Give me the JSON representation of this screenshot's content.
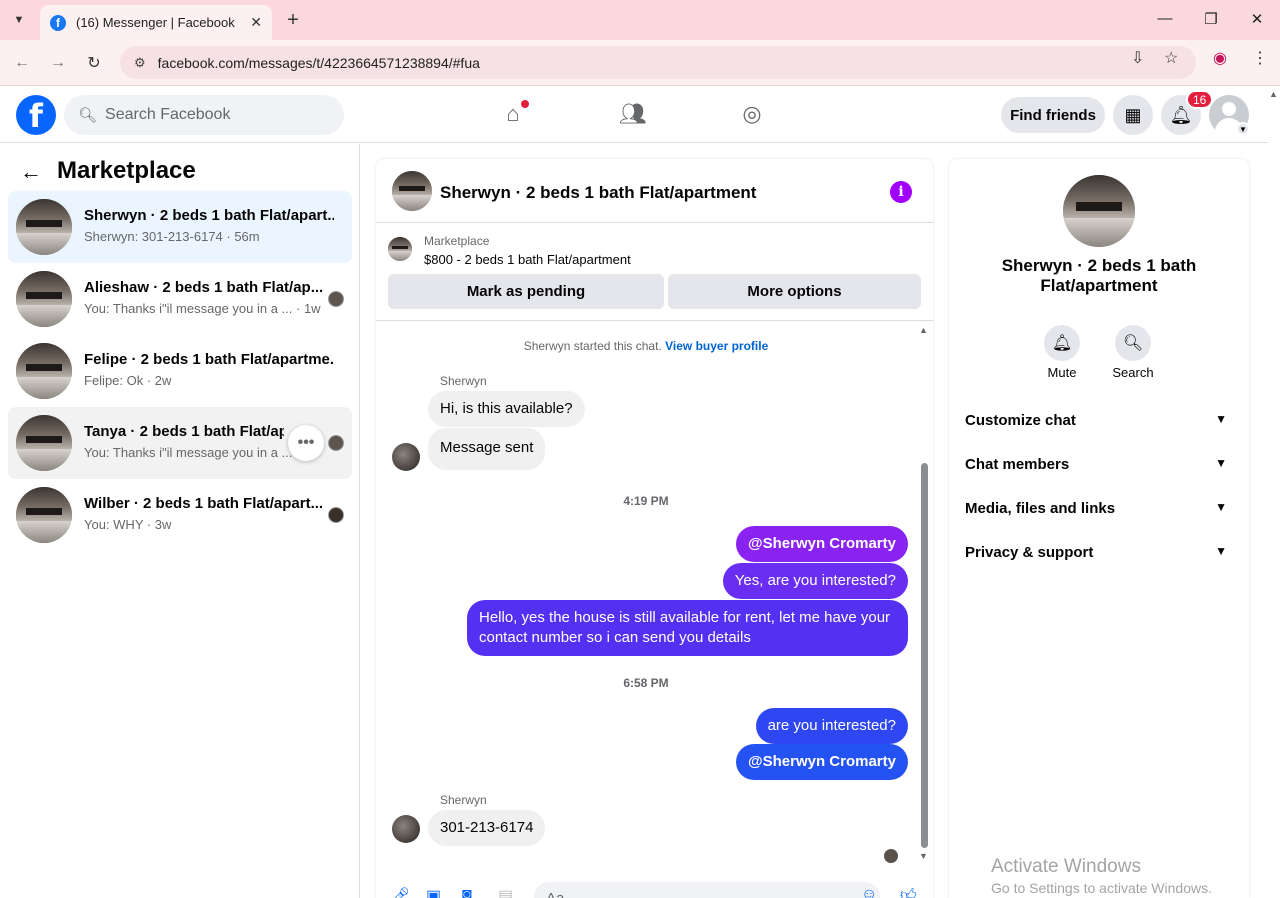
{
  "browser": {
    "tab_title": "(16) Messenger | Facebook",
    "tab_close": "✕",
    "new_tab": "+",
    "url": "facebook.com/messages/t/4223664571238894/#fua",
    "minimize": "—",
    "restore": "❐",
    "close": "✕"
  },
  "header": {
    "search_placeholder": "Search Facebook",
    "find_friends": "Find friends",
    "notifications_count": "16",
    "brand_color": "#0866ff"
  },
  "sidebar": {
    "title": "Marketplace",
    "conversations": [
      {
        "name": "Sherwyn · 2 beds 1 bath Flat/apart...",
        "snippet": "Sherwyn: 301-213-6174 · 56m"
      },
      {
        "name": "Alieshaw · 2 beds 1 bath Flat/ap...",
        "snippet": "You: Thanks i\"il message you in a ... · 1w"
      },
      {
        "name": "Felipe · 2 beds 1 bath Flat/apartme...",
        "snippet": "Felipe: Ok · 2w"
      },
      {
        "name": "Tanya · 2 beds 1 bath Flat/apart...",
        "snippet": "You: Thanks i\"il message you in a ..."
      },
      {
        "name": "Wilber · 2 beds 1 bath Flat/apart...",
        "snippet": "You: WHY · 3w"
      }
    ]
  },
  "chat": {
    "title": "Sherwyn · 2 beds 1 bath Flat/apartment",
    "marketplace_label": "Marketplace",
    "listing": "$800 - 2 beds 1 bath Flat/apartment",
    "mark_pending": "Mark as pending",
    "more_options": "More options",
    "system_message": "Sherwyn started this chat.",
    "view_buyer_profile": "View buyer profile",
    "sender_name": "Sherwyn",
    "messages": {
      "m1": "Hi, is this available?",
      "m2": "Message sent",
      "ts1": "4:19 PM",
      "m3": "@Sherwyn Cromarty",
      "m4": "Yes, are you interested?",
      "m5a": "Hello, yes the house is still available for rent, let me have your",
      "m5b": "contact number so i can send you details",
      "ts2": "6:58 PM",
      "m6": "are you interested?",
      "m7": "@Sherwyn Cromarty",
      "m8": "301-213-6174"
    },
    "composer_placeholder": "Aa",
    "outgoing_color_top": "#9b1ff0",
    "outgoing_color_bottom": "#1e5cf2"
  },
  "details": {
    "title_line1": "Sherwyn · 2 beds 1 bath",
    "title_line2": "Flat/apartment",
    "mute": "Mute",
    "search": "Search",
    "sections": [
      "Customize chat",
      "Chat members",
      "Media, files and links",
      "Privacy & support"
    ]
  },
  "watermark": {
    "line1": "Activate Windows",
    "line2": "Go to Settings to activate Windows."
  }
}
